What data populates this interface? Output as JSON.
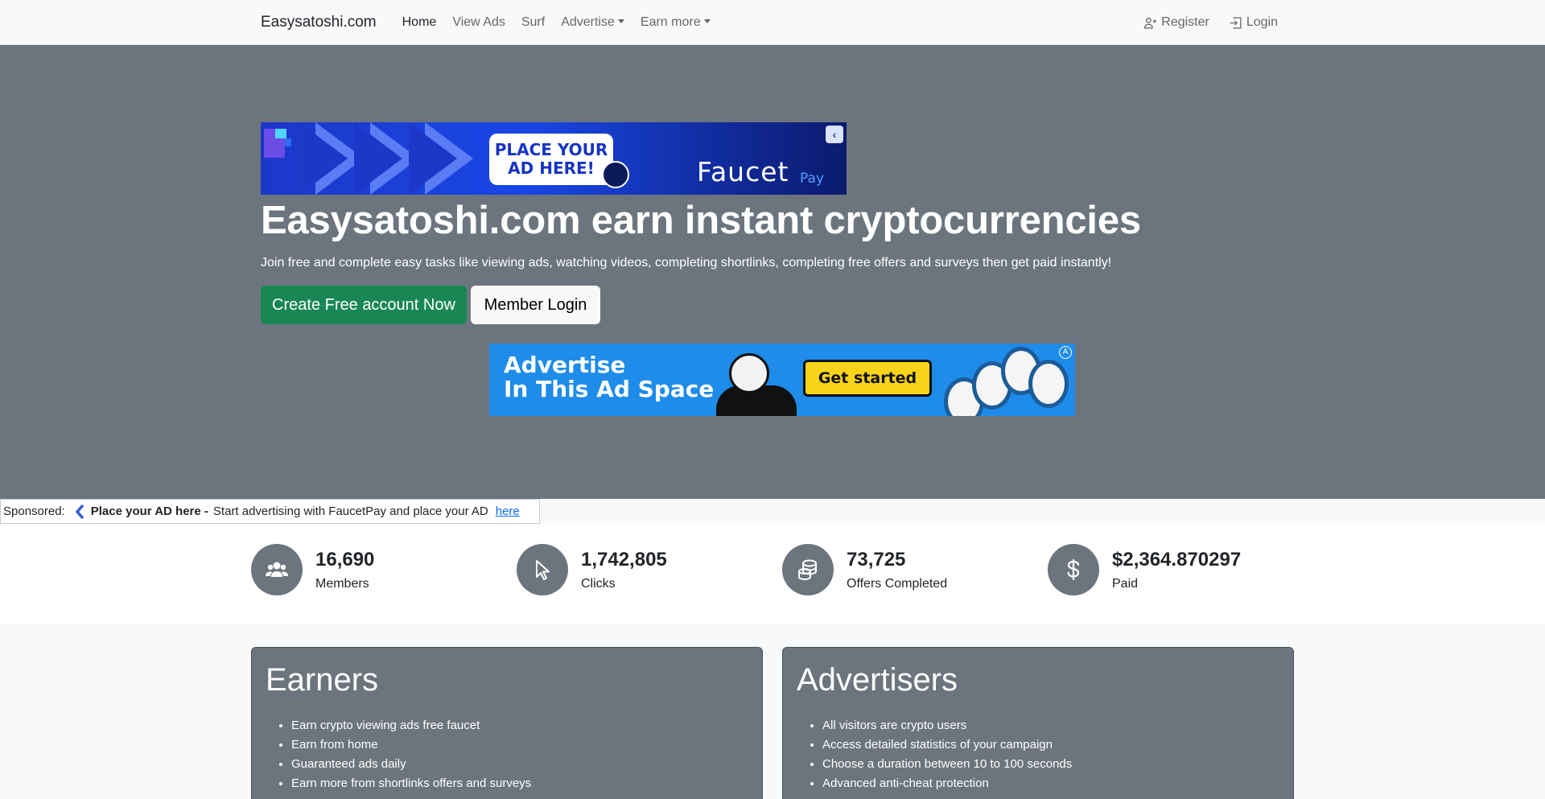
{
  "nav": {
    "brand": "Easysatoshi.com",
    "links": [
      "Home",
      "View Ads",
      "Surf",
      "Advertise",
      "Earn more"
    ],
    "register": "Register",
    "login": "Login"
  },
  "hero": {
    "banner1": {
      "place_line1": "PLACE YOUR",
      "place_line2": "AD HERE!",
      "brand": "Faucet",
      "brand_suffix": "Pay"
    },
    "title": "Easysatoshi.com earn instant cryptocurrencies",
    "lead": "Join free and complete easy tasks like viewing ads, watching videos, completing shortlinks, completing free offers and surveys then get paid instantly!",
    "cta_primary": "Create Free account Now",
    "cta_secondary": "Member Login",
    "banner2": {
      "line1": "Advertise",
      "line2": "In This Ad Space",
      "button": "Get started"
    }
  },
  "sponsored": {
    "prefix": "Sponsored:",
    "title": "Place your AD here -",
    "text": "Start advertising with FaucetPay and place your AD",
    "link": "here"
  },
  "stats": [
    {
      "icon": "users-icon",
      "value": "16,690",
      "label": "Members"
    },
    {
      "icon": "cursor-icon",
      "value": "1,742,805",
      "label": "Clicks"
    },
    {
      "icon": "coins-icon",
      "value": "73,725",
      "label": "Offers Completed"
    },
    {
      "icon": "dollar-icon",
      "value": "$2,364.870297",
      "label": "Paid"
    }
  ],
  "cards": {
    "earners": {
      "title": "Earners",
      "items": [
        "Earn crypto viewing ads free faucet",
        "Earn from home",
        "Guaranteed ads daily",
        "Earn more from shortlinks offers and surveys"
      ]
    },
    "advertisers": {
      "title": "Advertisers",
      "items": [
        "All visitors are crypto users",
        "Access detailed statistics of your campaign",
        "Choose a duration between 10 to 100 seconds",
        "Advanced anti-cheat protection"
      ]
    }
  },
  "colors": {
    "hero_bg": "#6c757d",
    "success": "#198754",
    "link": "#0d6efd"
  }
}
